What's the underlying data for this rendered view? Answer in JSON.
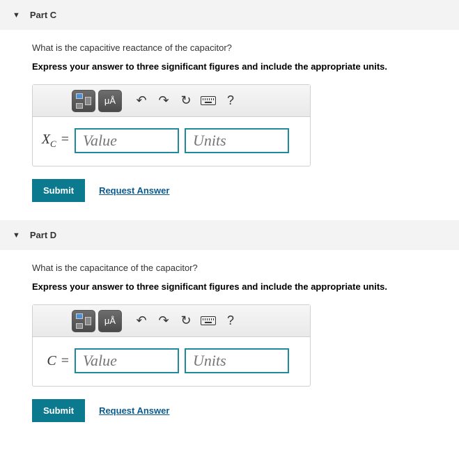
{
  "parts": [
    {
      "title": "Part C",
      "question": "What is the capacitive reactance of the capacitor?",
      "instruction": "Express your answer to three significant figures and include the appropriate units.",
      "variable_html": "X<sub>C</sub>",
      "value_placeholder": "Value",
      "units_placeholder": "Units",
      "submit_label": "Submit",
      "request_label": "Request Answer",
      "mu_a_label": "μÅ"
    },
    {
      "title": "Part D",
      "question": "What is the capacitance of the capacitor?",
      "instruction": "Express your answer to three significant figures and include the appropriate units.",
      "variable_html": "C",
      "value_placeholder": "Value",
      "units_placeholder": "Units",
      "submit_label": "Submit",
      "request_label": "Request Answer",
      "mu_a_label": "μÅ"
    }
  ]
}
